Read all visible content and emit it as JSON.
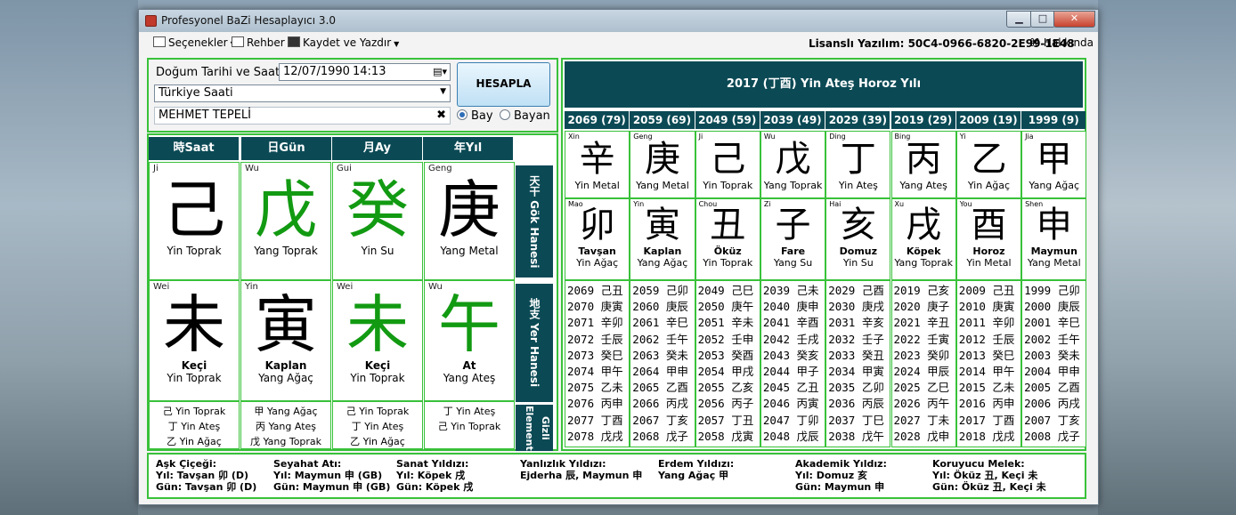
{
  "window": {
    "title": "Profesyonel BaZi Hesaplayıcı 3.0"
  },
  "menu": {
    "items": [
      "Seçenekler",
      "Rehber",
      "Kaydet ve Yazdır"
    ],
    "license": "Lisanslı Yazılım: 50C4-0966-6820-2E99-1E48",
    "about": "Hakkında"
  },
  "input": {
    "birth_label": "Doğum Tarihi ve Saati:",
    "date": "12/07/1990",
    "time": "14:13",
    "timezone": "Türkiye Saati",
    "name": "MEHMET TEPELİ",
    "calculate": "HESAPLA",
    "gender_male": "Bay",
    "gender_female": "Bayan",
    "gender_selected": "Bay"
  },
  "pillars": {
    "headers": [
      "時Saat",
      "日Gün",
      "月Ay",
      "年Yıl"
    ],
    "side_labels": [
      "天干 Gök Hanesi",
      "地支 Yer Hanesi",
      "Gizli Element"
    ],
    "stems": [
      {
        "pinyin": "Ji",
        "char": "己",
        "element": "Yin Toprak",
        "color": "black"
      },
      {
        "pinyin": "Wu",
        "char": "戊",
        "element": "Yang Toprak",
        "color": "green"
      },
      {
        "pinyin": "Gui",
        "char": "癸",
        "element": "Yin Su",
        "color": "green"
      },
      {
        "pinyin": "Geng",
        "char": "庚",
        "element": "Yang Metal",
        "color": "black"
      }
    ],
    "branches": [
      {
        "pinyin": "Wei",
        "char": "未",
        "animal": "Keçi",
        "element": "Yin Toprak",
        "color": "black"
      },
      {
        "pinyin": "Yin",
        "char": "寅",
        "animal": "Kaplan",
        "element": "Yang Ağaç",
        "color": "black"
      },
      {
        "pinyin": "Wei",
        "char": "未",
        "animal": "Keçi",
        "element": "Yin Toprak",
        "color": "green"
      },
      {
        "pinyin": "Wu",
        "char": "午",
        "animal": "At",
        "element": "Yang Ateş",
        "color": "green"
      }
    ],
    "hidden": [
      [
        "己 Yin Toprak",
        "丁 Yin Ateş",
        "乙 Yin Ağaç"
      ],
      [
        "甲 Yang Ağaç",
        "丙 Yang Ateş",
        "戊 Yang Toprak"
      ],
      [
        "己 Yin Toprak",
        "丁 Yin Ateş",
        "乙 Yin Ağaç"
      ],
      [
        "丁 Yin Ateş",
        "己 Yin Toprak"
      ]
    ]
  },
  "luck": {
    "title": "2017 (丁酉) Yin Ateş Horoz Yılı",
    "headers": [
      "2069 (79)",
      "2059 (69)",
      "2049 (59)",
      "2039 (49)",
      "2029 (39)",
      "2019 (29)",
      "2009 (19)",
      "1999 (9)"
    ],
    "stems": [
      {
        "pinyin": "Xin",
        "char": "辛",
        "element": "Yin Metal"
      },
      {
        "pinyin": "Geng",
        "char": "庚",
        "element": "Yang Metal"
      },
      {
        "pinyin": "Ji",
        "char": "己",
        "element": "Yin Toprak"
      },
      {
        "pinyin": "Wu",
        "char": "戊",
        "element": "Yang Toprak"
      },
      {
        "pinyin": "Ding",
        "char": "丁",
        "element": "Yin Ateş"
      },
      {
        "pinyin": "Bing",
        "char": "丙",
        "element": "Yang Ateş"
      },
      {
        "pinyin": "Yi",
        "char": "乙",
        "element": "Yin Ağaç"
      },
      {
        "pinyin": "Jia",
        "char": "甲",
        "element": "Yang Ağaç"
      }
    ],
    "branches": [
      {
        "pinyin": "Mao",
        "char": "卯",
        "animal": "Tavşan",
        "element": "Yin Ağaç"
      },
      {
        "pinyin": "Yin",
        "char": "寅",
        "animal": "Kaplan",
        "element": "Yang Ağaç"
      },
      {
        "pinyin": "Chou",
        "char": "丑",
        "animal": "Öküz",
        "element": "Yin Toprak"
      },
      {
        "pinyin": "Zi",
        "char": "子",
        "animal": "Fare",
        "element": "Yang Su"
      },
      {
        "pinyin": "Hai",
        "char": "亥",
        "animal": "Domuz",
        "element": "Yin Su"
      },
      {
        "pinyin": "Xu",
        "char": "戌",
        "animal": "Köpek",
        "element": "Yang Toprak"
      },
      {
        "pinyin": "You",
        "char": "酉",
        "animal": "Horoz",
        "element": "Yin Metal"
      },
      {
        "pinyin": "Shen",
        "char": "申",
        "animal": "Maymun",
        "element": "Yang Metal"
      }
    ],
    "years": [
      [
        "2069 己丑",
        "2070 庚寅",
        "2071 辛卯",
        "2072 壬辰",
        "2073 癸巳",
        "2074 甲午",
        "2075 乙未",
        "2076 丙申",
        "2077 丁酉",
        "2078 戊戌"
      ],
      [
        "2059 己卯",
        "2060 庚辰",
        "2061 辛巳",
        "2062 壬午",
        "2063 癸未",
        "2064 甲申",
        "2065 乙酉",
        "2066 丙戌",
        "2067 丁亥",
        "2068 戊子"
      ],
      [
        "2049 己巳",
        "2050 庚午",
        "2051 辛未",
        "2052 壬申",
        "2053 癸酉",
        "2054 甲戌",
        "2055 乙亥",
        "2056 丙子",
        "2057 丁丑",
        "2058 戊寅"
      ],
      [
        "2039 己未",
        "2040 庚申",
        "2041 辛酉",
        "2042 壬戌",
        "2043 癸亥",
        "2044 甲子",
        "2045 乙丑",
        "2046 丙寅",
        "2047 丁卯",
        "2048 戊辰"
      ],
      [
        "2029 己酉",
        "2030 庚戌",
        "2031 辛亥",
        "2032 壬子",
        "2033 癸丑",
        "2034 甲寅",
        "2035 乙卯",
        "2036 丙辰",
        "2037 丁巳",
        "2038 戊午"
      ],
      [
        "2019 己亥",
        "2020 庚子",
        "2021 辛丑",
        "2022 壬寅",
        "2023 癸卯",
        "2024 甲辰",
        "2025 乙巳",
        "2026 丙午",
        "2027 丁未",
        "2028 戊申"
      ],
      [
        "2009 己丑",
        "2010 庚寅",
        "2011 辛卯",
        "2012 壬辰",
        "2013 癸巳",
        "2014 甲午",
        "2015 乙未",
        "2016 丙申",
        "2017 丁酉",
        "2018 戊戌"
      ],
      [
        "1999 己卯",
        "2000 庚辰",
        "2001 辛巳",
        "2002 壬午",
        "2003 癸未",
        "2004 甲申",
        "2005 乙酉",
        "2006 丙戌",
        "2007 丁亥",
        "2008 戊子"
      ]
    ]
  },
  "stars": [
    {
      "title": "Aşk Çiçeği:",
      "lines": [
        "Yıl: Tavşan 卯 (D)",
        "Gün: Tavşan 卯 (D)"
      ]
    },
    {
      "title": "Seyahat Atı:",
      "lines": [
        "Yıl: Maymun 申 (GB)",
        "Gün: Maymun 申 (GB)"
      ]
    },
    {
      "title": "Sanat Yıldızı:",
      "lines": [
        "Yıl: Köpek 戌",
        "Gün: Köpek 戌"
      ]
    },
    {
      "title": "Yanlızlık Yıldızı:",
      "lines": [
        "Ejderha 辰, Maymun 申"
      ]
    },
    {
      "title": "Erdem Yıldızı:",
      "lines": [
        "Yang Ağaç 甲"
      ]
    },
    {
      "title": "Akademik Yıldız:",
      "lines": [
        "Yıl: Domuz 亥",
        "Gün: Maymun 申"
      ]
    },
    {
      "title": "Koruyucu Melek:",
      "lines": [
        "Yıl: Öküz 丑, Keçi 未",
        "Gün: Öküz 丑, Keçi 未"
      ]
    }
  ],
  "colors": {
    "header_bg": "#0b4a55",
    "border_green": "#39c13a",
    "char_green": "#129a12"
  }
}
